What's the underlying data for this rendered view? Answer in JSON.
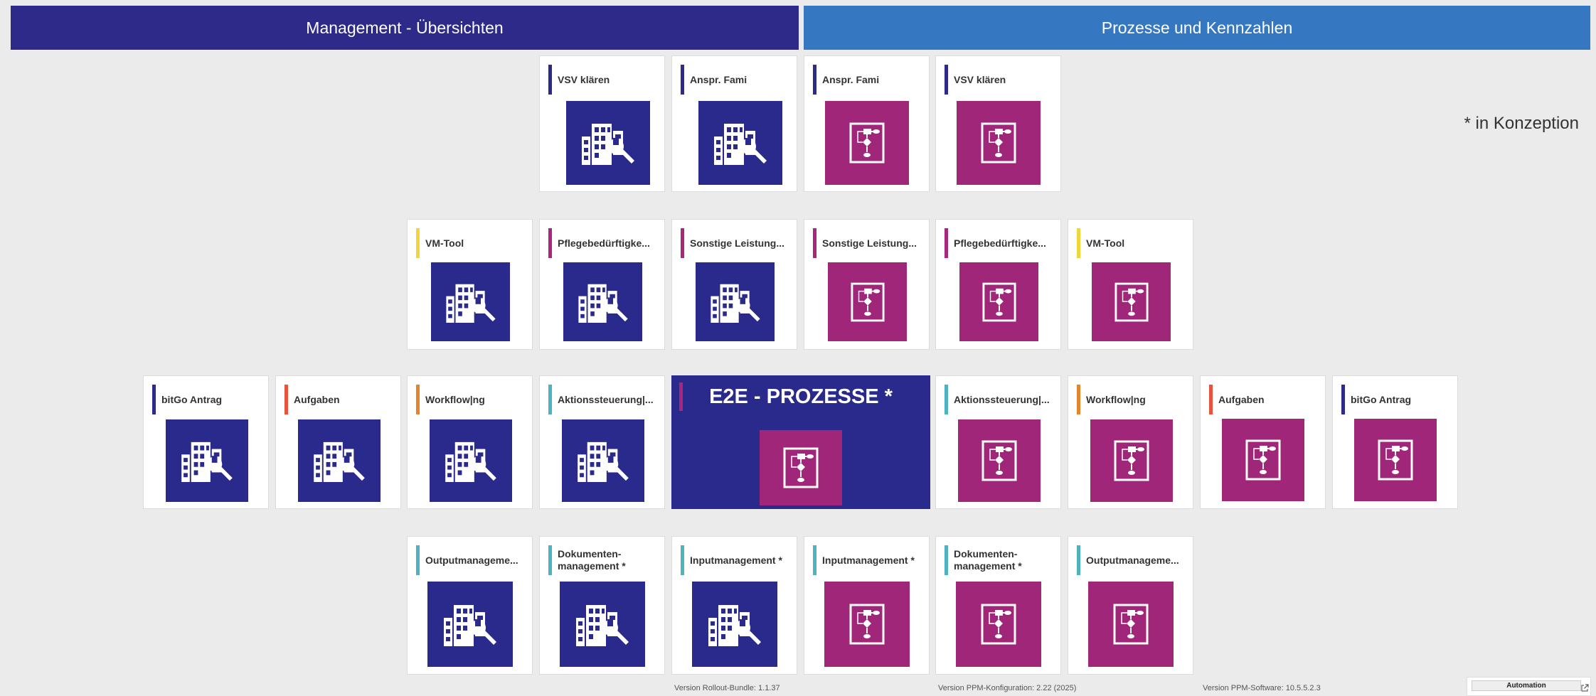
{
  "header": {
    "management_title": "Management - Übersichten",
    "processes_title": "Prozesse und Kennzahlen"
  },
  "note": "* in Konzeption",
  "center_tile": {
    "title": "E2E - PROZESSE *",
    "icon": "process-flowchart-icon"
  },
  "tiles": {
    "r1": [
      {
        "label": "VSV klären",
        "accent": "#2d2a8a",
        "icon": "building-wrench-icon"
      },
      {
        "label": "Anspr. Fami",
        "accent": "#2d2a8a",
        "icon": "building-wrench-icon"
      },
      {
        "label": "Anspr. Fami",
        "accent": "#2d2a8a",
        "icon": "process-flowchart-icon"
      },
      {
        "label": "VSV klären",
        "accent": "#2d2a8a",
        "icon": "process-flowchart-icon"
      }
    ],
    "r2": [
      {
        "label": "VM-Tool",
        "accent": "#f0d63a",
        "icon": "building-wrench-icon"
      },
      {
        "label": "Pflegebedürftigke...",
        "accent": "#a8277d",
        "icon": "building-wrench-icon"
      },
      {
        "label": "Sonstige Leistung...",
        "accent": "#a8277d",
        "icon": "building-wrench-icon"
      },
      {
        "label": "Sonstige Leistung...",
        "accent": "#a8277d",
        "icon": "process-flowchart-icon"
      },
      {
        "label": "Pflegebedürftigke...",
        "accent": "#a8277d",
        "icon": "process-flowchart-icon"
      },
      {
        "label": "VM-Tool",
        "accent": "#f0d63a",
        "icon": "process-flowchart-icon"
      }
    ],
    "r3": [
      {
        "label": "bitGo Antrag",
        "accent": "#2d2a8a",
        "icon": "building-wrench-icon"
      },
      {
        "label": "Aufgaben",
        "accent": "#e8533d",
        "icon": "building-wrench-icon"
      },
      {
        "label": "Workflow|ng",
        "accent": "#e5852b",
        "icon": "building-wrench-icon"
      },
      {
        "label": "Aktionssteuerung|...",
        "accent": "#4fb3bf",
        "icon": "building-wrench-icon"
      },
      {
        "label": "Aktionssteuerung|...",
        "accent": "#4fb3bf",
        "icon": "process-flowchart-icon"
      },
      {
        "label": "Workflow|ng",
        "accent": "#e5852b",
        "icon": "process-flowchart-icon"
      },
      {
        "label": "Aufgaben",
        "accent": "#e8533d",
        "icon": "process-flowchart-icon"
      },
      {
        "label": "bitGo Antrag",
        "accent": "#2d2a8a",
        "icon": "process-flowchart-icon"
      }
    ],
    "r4": [
      {
        "label": "Outputmanageme...",
        "accent": "#4fb3bf",
        "icon": "building-wrench-icon"
      },
      {
        "label": "Dokumenten-management *",
        "accent": "#4fb3bf",
        "icon": "building-wrench-icon"
      },
      {
        "label": "Inputmanagement *",
        "accent": "#4fb3bf",
        "icon": "building-wrench-icon"
      },
      {
        "label": "Inputmanagement *",
        "accent": "#4fb3bf",
        "icon": "process-flowchart-icon"
      },
      {
        "label": "Dokumenten-management *",
        "accent": "#4fb3bf",
        "icon": "process-flowchart-icon"
      },
      {
        "label": "Outputmanageme...",
        "accent": "#4fb3bf",
        "icon": "process-flowchart-icon"
      }
    ]
  },
  "footer": {
    "rollout": "Version Rollout-Bundle: 1.1.37",
    "ppm_config": "Version PPM-Konfiguration: 2.22 (2025)",
    "ppm_software": "Version PPM-Software: 10.5.5.2.3",
    "automation": "Automation"
  },
  "colors": {
    "management_blue": "#2d2a8a",
    "process_blue": "#3578c1",
    "tile_blue": "#2a2a8c",
    "tile_magenta": "#a02679"
  }
}
